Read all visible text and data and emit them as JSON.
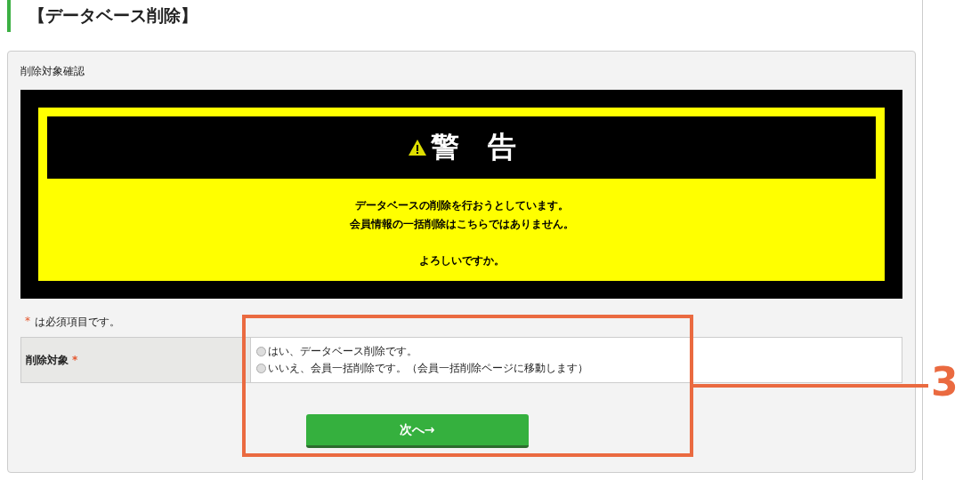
{
  "page_title": "【データベース削除】",
  "section_label": "削除対象確認",
  "warning": {
    "title": "警　告",
    "messages": [
      "データベースの削除を行おうとしています。",
      "会員情報の一括削除はこちらではありません。"
    ],
    "question": "よろしいですか。"
  },
  "required_note": {
    "mark": "*",
    "text": "は必須項目です。"
  },
  "form": {
    "label": "削除対象",
    "required_mark": "*",
    "options": [
      {
        "label": "はい、データベース削除です。",
        "selected": false
      },
      {
        "label": "いいえ、会員一括削除です。（会員一括削除ページに移動します）",
        "selected": false
      }
    ]
  },
  "next_button": "次へ→",
  "annotation": {
    "label": "3"
  }
}
